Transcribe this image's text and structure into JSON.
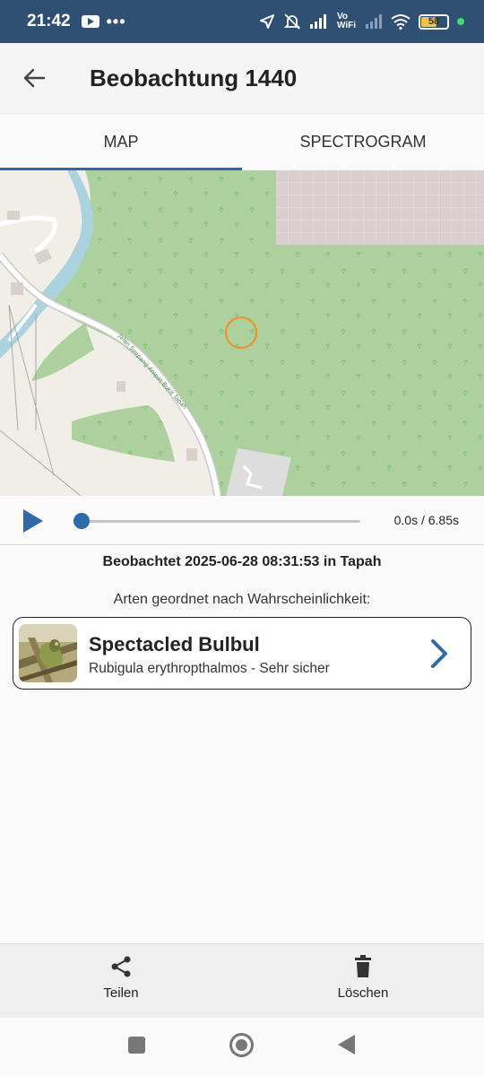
{
  "status_bar": {
    "time": "21:42",
    "dots": "•••",
    "network": "Vo WiFi",
    "battery": "58"
  },
  "app_bar": {
    "title": "Beobachtung 1440",
    "back_icon": "arrow-left-icon"
  },
  "tabs": [
    {
      "label": "MAP",
      "active": true
    },
    {
      "label": "SPECTROGRAM",
      "active": false
    }
  ],
  "map": {
    "street_label": "Jalan Simpang Ampat Bukit Tapah"
  },
  "player": {
    "time": "0.0s / 6.85s",
    "progress": 0
  },
  "observation": {
    "text": "Beobachtet 2025-06-28 08:31:53 in Tapah",
    "species_header": "Arten geordnet nach Wahrscheinlichkeit:"
  },
  "species": [
    {
      "name": "Spectacled Bulbul",
      "detail": "Rubigula erythropthalmos - Sehr sicher"
    }
  ],
  "actions": {
    "share": "Teilen",
    "delete": "Löschen"
  },
  "colors": {
    "accent": "#2e6aa8",
    "status_bar": "#2f4f73",
    "map_marker": "#f0932b",
    "forest": "#add19e"
  }
}
